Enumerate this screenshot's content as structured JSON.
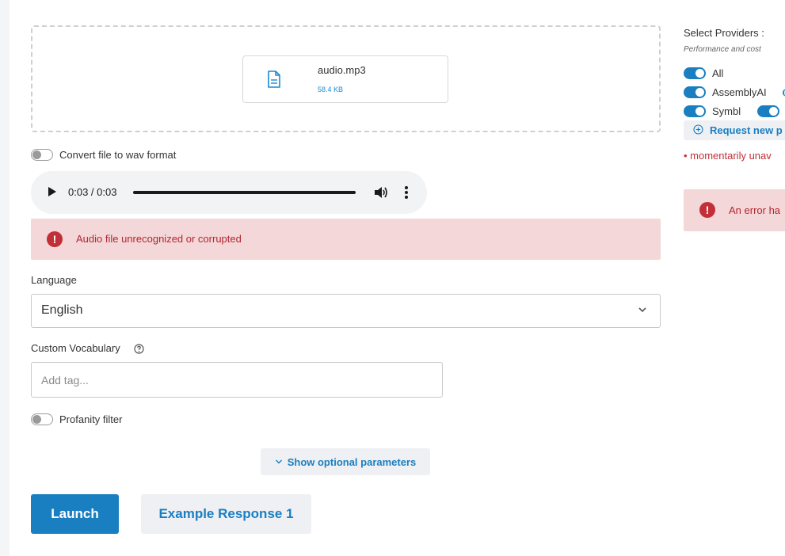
{
  "upload": {
    "file_name": "audio.mp3",
    "file_size": "58.4 KB"
  },
  "convert_toggle": {
    "label": "Convert file to wav format",
    "on": false
  },
  "player": {
    "time": "0:03 / 0:03"
  },
  "error": {
    "message": "Audio file unrecognized or corrupted"
  },
  "language": {
    "label": "Language",
    "value": "English"
  },
  "vocabulary": {
    "label": "Custom Vocabulary",
    "placeholder": "Add tag..."
  },
  "profanity": {
    "label": "Profanity filter",
    "on": false
  },
  "optional_params_button": "Show optional parameters",
  "actions": {
    "launch": "Launch",
    "example": "Example Response 1"
  },
  "providers": {
    "title": "Select Providers :",
    "subtitle": "Performance and cost",
    "items": [
      {
        "label": "All",
        "on": true
      },
      {
        "label": "AssemblyAI",
        "on": true
      },
      {
        "label": "Symbl",
        "on": true
      }
    ],
    "request_new": "Request new p",
    "unavailable": "• momentarily unav",
    "error_text": "An error ha"
  },
  "colors": {
    "accent": "#1a7fc1",
    "error": "#c22f36",
    "error_bg": "#f3d7d9"
  }
}
